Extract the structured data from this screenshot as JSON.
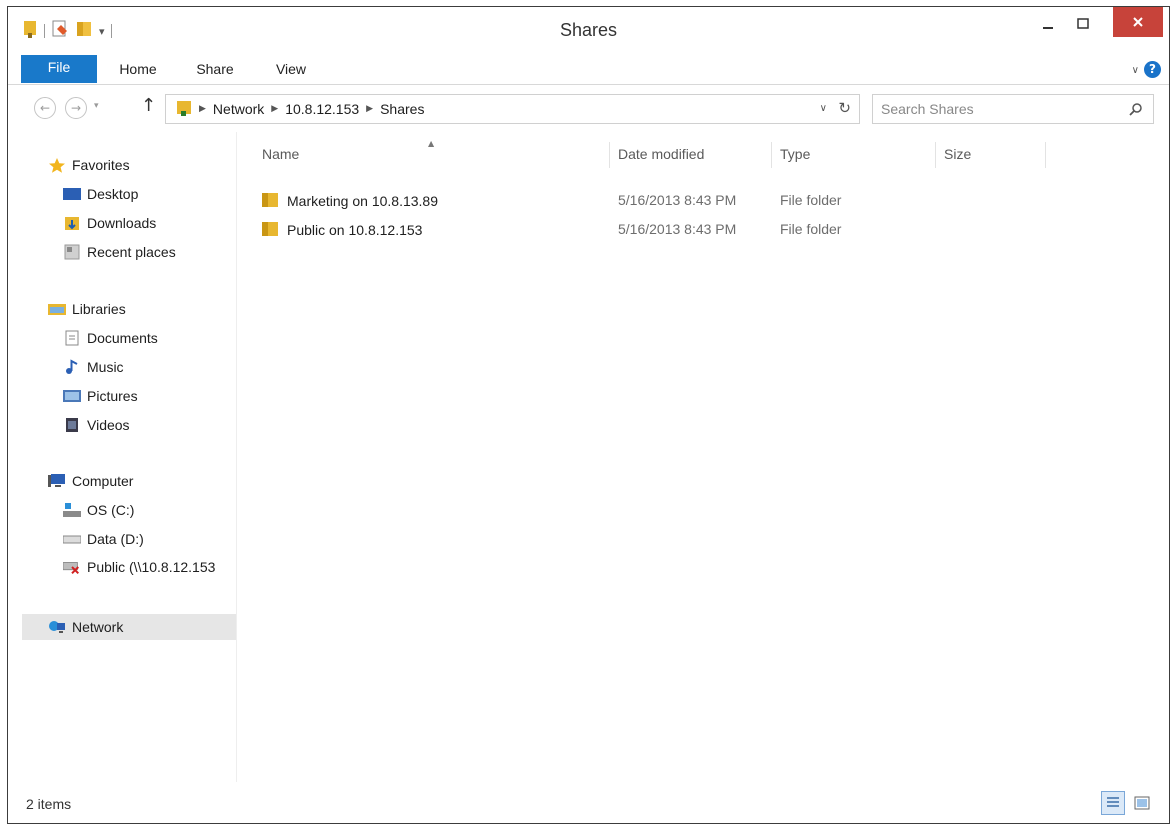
{
  "window": {
    "title": "Shares"
  },
  "ribbon": {
    "tabs": [
      "File",
      "Home",
      "Share",
      "View"
    ]
  },
  "address": {
    "crumbs": [
      "Network",
      "10.8.12.153",
      "Shares"
    ],
    "search_placeholder": "Search Shares"
  },
  "navpane": {
    "favorites": {
      "label": "Favorites",
      "items": [
        "Desktop",
        "Downloads",
        "Recent places"
      ]
    },
    "libraries": {
      "label": "Libraries",
      "items": [
        "Documents",
        "Music",
        "Pictures",
        "Videos"
      ]
    },
    "computer": {
      "label": "Computer",
      "items": [
        "OS (C:)",
        "Data (D:)",
        "Public (\\\\10.8.12.153"
      ]
    },
    "network": {
      "label": "Network"
    }
  },
  "filelist": {
    "columns": [
      "Name",
      "Date modified",
      "Type",
      "Size"
    ],
    "rows": [
      {
        "name": "Marketing on 10.8.13.89",
        "date": "5/16/2013 8:43 PM",
        "type": "File folder"
      },
      {
        "name": "Public on 10.8.12.153",
        "date": "5/16/2013 8:43 PM",
        "type": "File folder"
      }
    ]
  },
  "status": {
    "item_count": "2 items"
  },
  "colors": {
    "accent": "#1979ca",
    "close": "#c7433a",
    "folder": "#e8b730",
    "selected": "#e6e6e6"
  }
}
